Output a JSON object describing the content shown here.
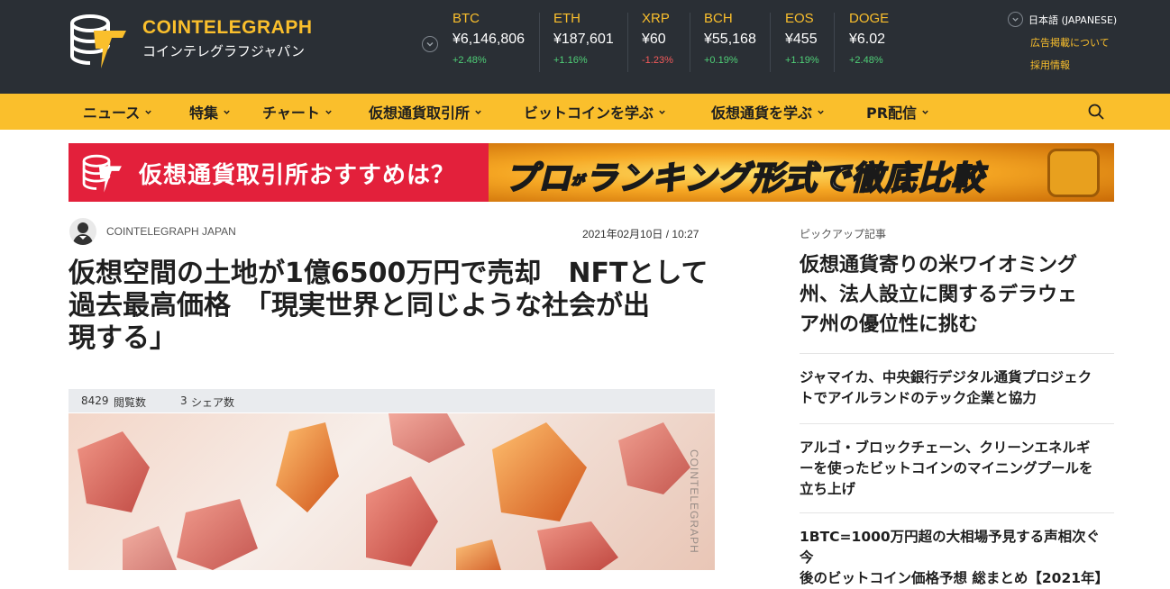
{
  "header": {
    "brand": "COINTELEGRAPH",
    "brand_sub": "コインテレグラフジャパン",
    "tickers": [
      {
        "symbol": "BTC",
        "price": "¥6,146,806",
        "change": "+2.48%",
        "direction": "up"
      },
      {
        "symbol": "ETH",
        "price": "¥187,601",
        "change": "+1.16%",
        "direction": "up"
      },
      {
        "symbol": "XRP",
        "price": "¥60",
        "change": "-1.23%",
        "direction": "down"
      },
      {
        "symbol": "BCH",
        "price": "¥55,168",
        "change": "+0.19%",
        "direction": "up"
      },
      {
        "symbol": "EOS",
        "price": "¥455",
        "change": "+1.19%",
        "direction": "up"
      },
      {
        "symbol": "DOGE",
        "price": "¥6.02",
        "change": "+2.48%",
        "direction": "up"
      }
    ],
    "language": "日本語 (JAPANESE)",
    "links": [
      "広告掲載について",
      "採用情報"
    ]
  },
  "nav": {
    "items": [
      "ニュース",
      "特集",
      "チャート",
      "仮想通貨取引所",
      "ビットコインを学ぶ",
      "仮想通貨を学ぶ",
      "PR配信"
    ]
  },
  "banner": {
    "left_text": "仮想通貨取引所おすすめは？",
    "right_pre": "プロ",
    "right_small": "が",
    "right_text": "ランキング形式で徹底比較"
  },
  "article": {
    "author": "COINTELEGRAPH JAPAN",
    "date": "2021年02月10日 / 10:27",
    "headline_lines": [
      "仮想空間の土地が1億6500万円で売却　NFTとして",
      "過去最高価格　「現実世界と同じような社会が出",
      "現する」"
    ],
    "views_count": "8429",
    "views_label": "閲覧数",
    "shares_count": "3",
    "shares_label": "シェア数"
  },
  "sidebar": {
    "label": "ピックアップ記事",
    "main_lines": [
      "仮想通貨寄りの米ワイオミング",
      "州、法人設立に関するデラウェ",
      "ア州の優位性に挑む"
    ],
    "items": [
      {
        "lines": [
          "ジャマイカ、中央銀行デジタル通貨プロジェク",
          "トでアイルランドのテック企業と協力"
        ]
      },
      {
        "lines": [
          "アルゴ・ブロックチェーン、クリーンエネルギ",
          "ーを使ったビットコインのマイニングプールを",
          "立ち上げ"
        ]
      },
      {
        "lines": [
          "1BTC=1000万円超の大相場予見する声相次ぐ 今",
          "後のビットコイン価格予想 総まとめ【2021年】"
        ]
      }
    ]
  },
  "colors": {
    "header_bg": "#2a2f35",
    "accent": "#fabf2c",
    "up": "#4fcf77",
    "down": "#f45a5a",
    "banner_red": "#e3203b"
  }
}
